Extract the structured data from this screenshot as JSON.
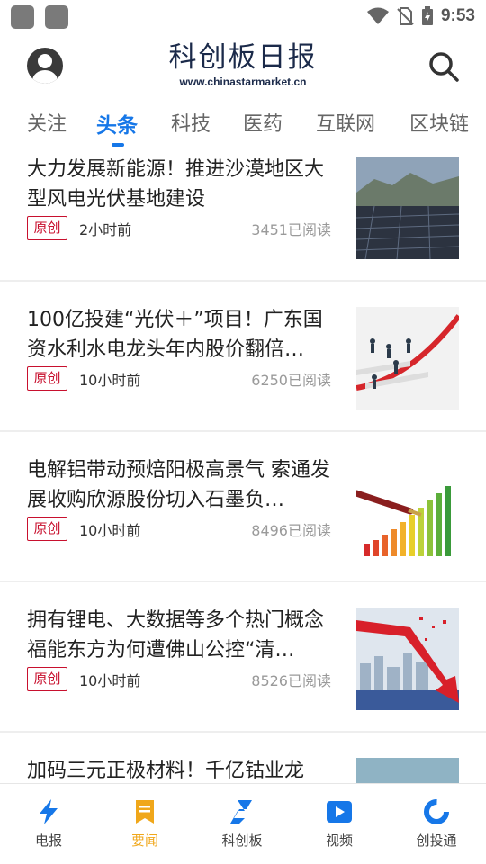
{
  "status_bar": {
    "time": "9:53"
  },
  "header": {
    "title": "科创板日报",
    "url": "www.chinastarmarket.cn"
  },
  "tabs": [
    "关注",
    "头条",
    "科技",
    "医药",
    "互联网",
    "区块链"
  ],
  "articles": [
    {
      "title": "大力发展新能源！推进沙漠地区大型风电光伏基地建设",
      "badge": "原创",
      "time": "2小时前",
      "reads": "3451已阅读"
    },
    {
      "title": "100亿投建“光伏＋”项目！广东国资水利水电龙头年内股价翻倍…",
      "badge": "原创",
      "time": "10小时前",
      "reads": "6250已阅读"
    },
    {
      "title": "电解铝带动预焙阳极高景气 索通发展收购欣源股份切入石墨负…",
      "badge": "原创",
      "time": "10小时前",
      "reads": "8496已阅读"
    },
    {
      "title": "拥有锂电、大数据等多个热门概念 福能东方为何遭佛山公控“清…",
      "badge": "原创",
      "time": "10小时前",
      "reads": "8526已阅读"
    },
    {
      "title": "加码三元正极材料！千亿钴业龙"
    }
  ],
  "bottom_nav": [
    {
      "label": "电报",
      "icon": "lightning-icon"
    },
    {
      "label": "要闻",
      "icon": "bookmark-icon"
    },
    {
      "label": "科创板",
      "icon": "s-logo-icon"
    },
    {
      "label": "视频",
      "icon": "play-icon"
    },
    {
      "label": "创投通",
      "icon": "ring-icon"
    }
  ],
  "colors": {
    "accent": "#1677e8",
    "badge": "#c8102e",
    "nav_active": "#f0a71a"
  }
}
